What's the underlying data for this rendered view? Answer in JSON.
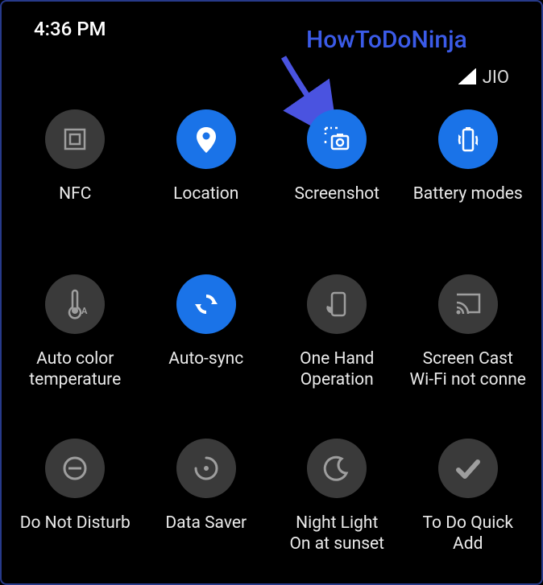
{
  "statusbar": {
    "time": "4:36 PM",
    "carrier": "JIO"
  },
  "annotation": {
    "text": "HowToDoNinja"
  },
  "tiles": {
    "nfc": {
      "label": "NFC",
      "sub": "",
      "active": false
    },
    "location": {
      "label": "Location",
      "sub": "",
      "active": true
    },
    "screenshot": {
      "label": "Screenshot",
      "sub": "",
      "active": true
    },
    "battery": {
      "label": "Battery modes",
      "sub": "",
      "active": true
    },
    "autocolor": {
      "label": "Auto color",
      "sub": "temperature",
      "active": false
    },
    "autosync": {
      "label": "Auto-sync",
      "sub": "",
      "active": true
    },
    "onehand": {
      "label": "One Hand",
      "sub": "Operation",
      "active": false
    },
    "cast": {
      "label": "Screen Cast",
      "sub": "Wi-Fi not conne",
      "active": false
    },
    "dnd": {
      "label": "Do Not Disturb",
      "sub": "",
      "active": false
    },
    "datasaver": {
      "label": "Data Saver",
      "sub": "",
      "active": false
    },
    "nightlight": {
      "label": "Night Light",
      "sub": "On at sunset",
      "active": false
    },
    "todo": {
      "label": "To Do Quick",
      "sub": "Add",
      "active": false
    }
  }
}
